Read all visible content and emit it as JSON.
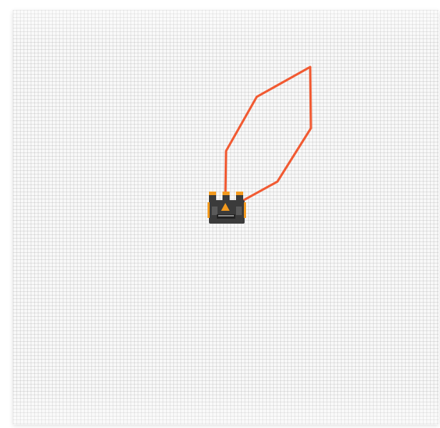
{
  "canvas": {
    "background_color": "#f8f8f8",
    "grid_color": "#aaaaaa"
  },
  "path": {
    "stroke_color": "#f15a32",
    "icon": "orange-path-line"
  },
  "rover": {
    "icon": "rover-castle-icon",
    "body_color": "#3b3b3b",
    "accent_color": "#f39a1e"
  }
}
